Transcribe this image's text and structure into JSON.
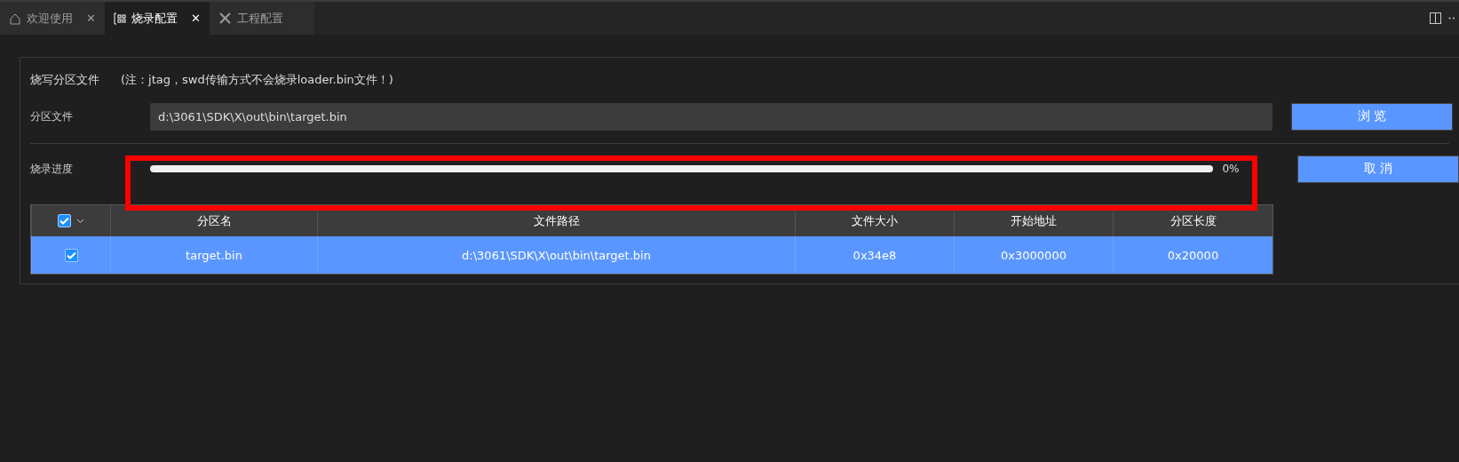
{
  "tabs": [
    {
      "label": "欢迎使用",
      "close": "✕",
      "selected": false
    },
    {
      "label": "烧录配置",
      "close": "✕",
      "selected": true
    },
    {
      "label": "工程配置",
      "selected": false
    }
  ],
  "panel": {
    "title": "烧写分区文件",
    "note": "(注：jtag，swd传输方式不会烧录loader.bin文件！)",
    "file_label": "分区文件",
    "file_value": "d:\\3061\\SDK\\X\\out\\bin\\target.bin",
    "browse_button": "浏 览",
    "progress_label": "烧录进度",
    "progress": {
      "level": 0,
      "reading": "0%"
    },
    "cancel_button": "取 消",
    "table": {
      "all_checked": true,
      "columns": [
        "分区名",
        "文件路径",
        "文件大小",
        "开始地址",
        "分区长度"
      ],
      "rows": [
        {
          "checked": true,
          "selected": true,
          "cells": [
            "target.bin",
            "d:\\3061\\SDK\\X\\out\\bin\\target.bin",
            "0x34e8",
            "0x3000000",
            "0x20000"
          ]
        }
      ]
    }
  },
  "highlight": {
    "on": true
  }
}
